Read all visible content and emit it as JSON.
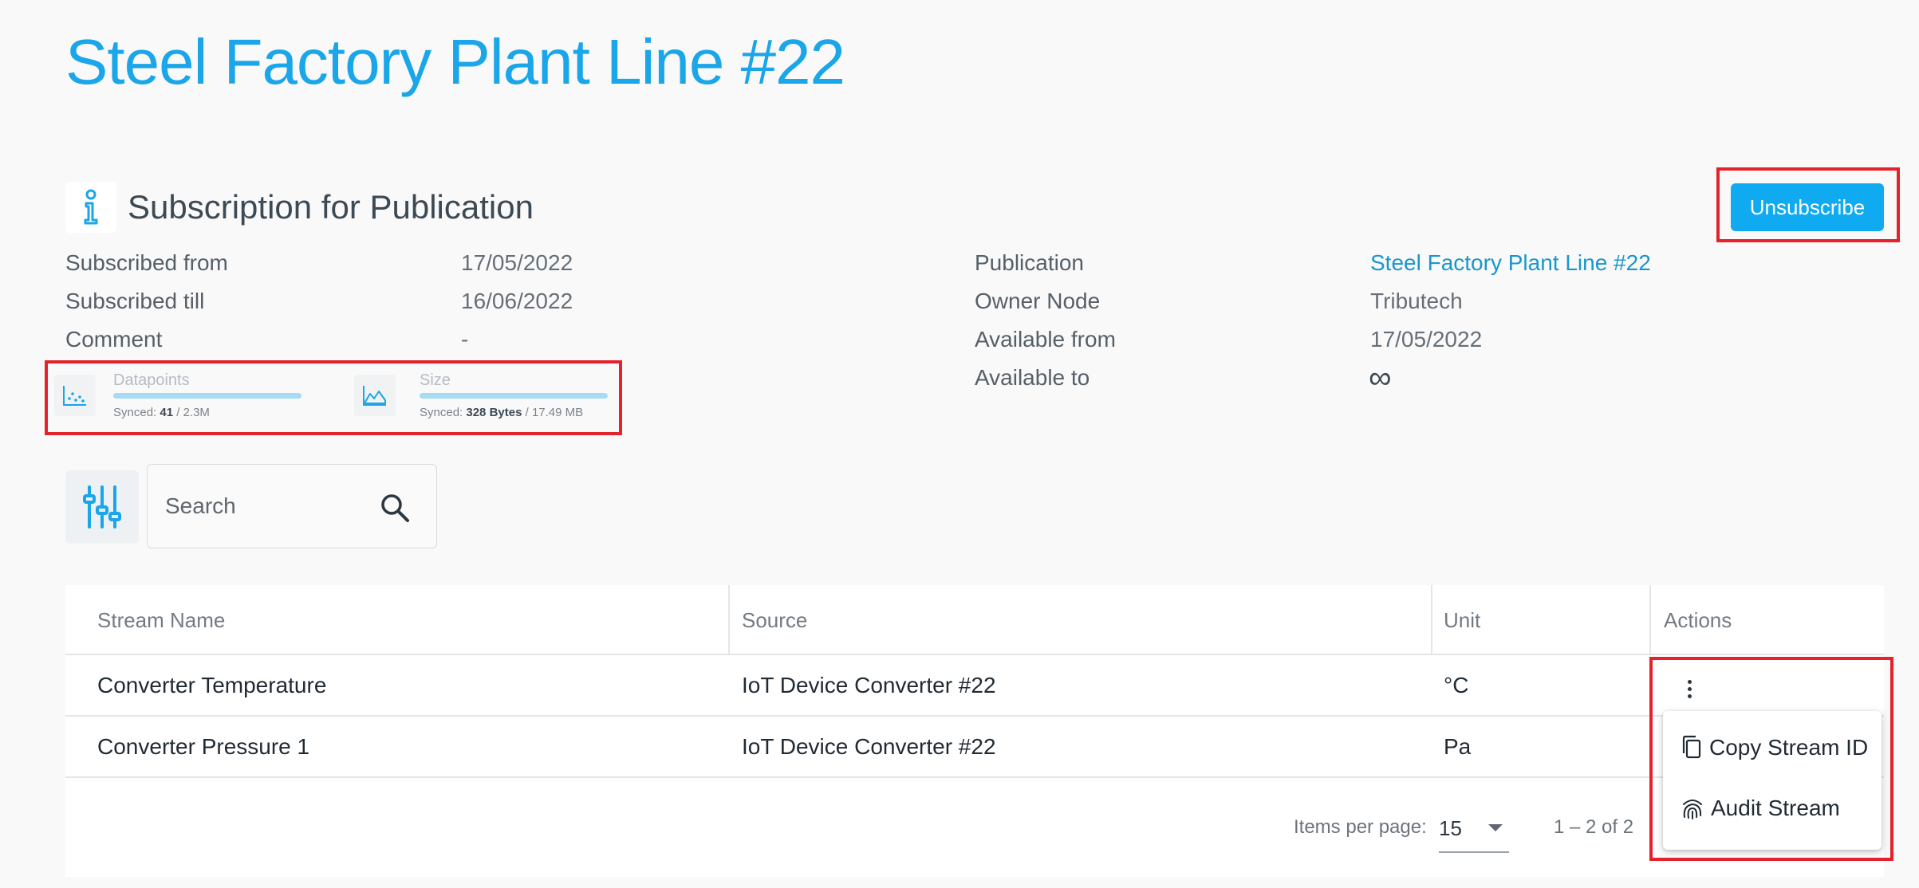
{
  "page": {
    "title": "Steel Factory Plant Line #22"
  },
  "section": {
    "title": "Subscription for Publication"
  },
  "actions": {
    "unsubscribe_label": "Unsubscribe"
  },
  "details_left": [
    {
      "label": "Subscribed from",
      "value": "17/05/2022"
    },
    {
      "label": "Subscribed till",
      "value": "16/06/2022"
    },
    {
      "label": "Comment",
      "value": "-"
    }
  ],
  "details_right": [
    {
      "label": "Publication",
      "value": "Steel Factory Plant Line #22"
    },
    {
      "label": "Owner Node",
      "value": "Tributech"
    },
    {
      "label": "Available from",
      "value": "17/05/2022"
    },
    {
      "label": "Available to",
      "value": "∞"
    }
  ],
  "stats": {
    "datapoints": {
      "label": "Datapoints",
      "synced_prefix": "Synced:",
      "synced": "41",
      "total": "/ 2.3M",
      "progress": 0.0
    },
    "size": {
      "label": "Size",
      "synced_prefix": "Synced:",
      "synced": "328 Bytes",
      "total": "/ 17.49 MB",
      "progress": 0.0
    }
  },
  "search": {
    "placeholder": "Search",
    "value": ""
  },
  "table": {
    "columns": [
      "Stream Name",
      "Source",
      "Unit",
      "Actions"
    ],
    "rows": [
      {
        "stream_name": "Converter Temperature",
        "source": "IoT Device Converter #22",
        "unit": "°C"
      },
      {
        "stream_name": "Converter Pressure 1",
        "source": "IoT Device Converter #22",
        "unit": "Pa"
      }
    ]
  },
  "paginator": {
    "items_per_page_label": "Items per page:",
    "page_size": "15",
    "range_label": "1 – 2 of 2"
  },
  "row_menu": {
    "items": [
      "Copy Stream ID",
      "Audit Stream"
    ]
  },
  "colors": {
    "accent": "#10aaf0",
    "title": "#1aa6e8",
    "highlight": "#e5222c"
  },
  "icons": {
    "section": "info-icon",
    "filter": "tune-icon",
    "search": "search-icon",
    "datapoints": "scatter-chart-icon",
    "size": "area-chart-icon",
    "actions": "more-vert-icon",
    "copy": "copy-icon",
    "audit": "fingerprint-icon"
  }
}
